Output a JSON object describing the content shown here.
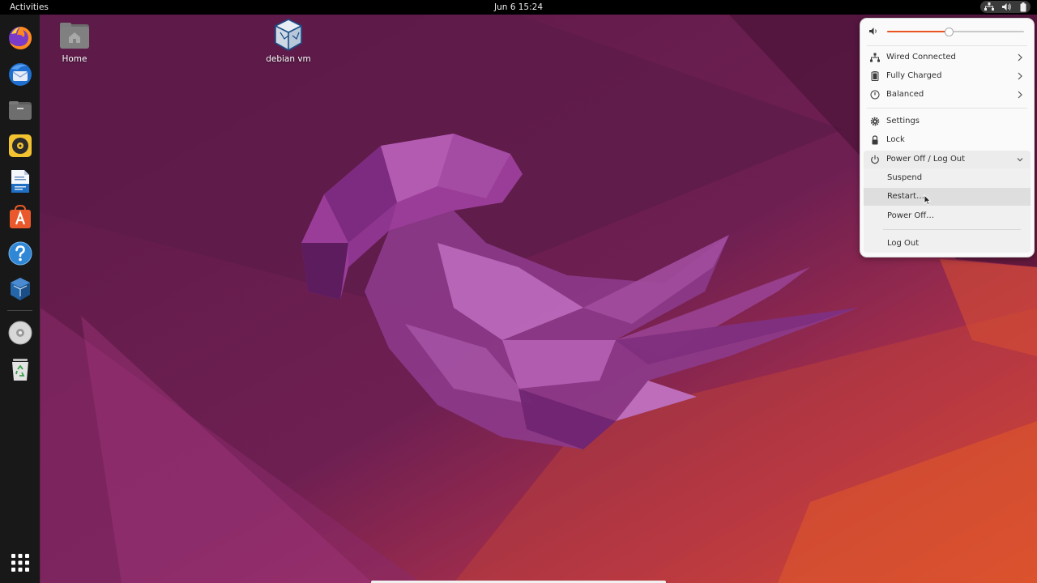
{
  "topbar": {
    "activities": "Activities",
    "clock": "Jun 6  15:24",
    "tray_icons": [
      "network-icon",
      "volume-icon",
      "battery-icon"
    ]
  },
  "dock": {
    "items": [
      {
        "name": "firefox-icon"
      },
      {
        "name": "thunderbird-icon"
      },
      {
        "name": "files-icon"
      },
      {
        "name": "rhythmbox-icon"
      },
      {
        "name": "libreoffice-writer-icon"
      },
      {
        "name": "app-center-icon"
      },
      {
        "name": "help-icon"
      },
      {
        "name": "virtualbox-icon"
      },
      {
        "name": "optical-disc-icon"
      },
      {
        "name": "trash-icon"
      }
    ],
    "apps_grid": "show-apps-icon"
  },
  "desktop": {
    "icons": [
      {
        "label": "Home",
        "icon": "home-folder-icon"
      },
      {
        "label": "debian vm",
        "icon": "virtualbox-vm-icon"
      }
    ]
  },
  "system_menu": {
    "volume": {
      "icon": "speaker-icon",
      "level": 0.45
    },
    "rows": [
      {
        "label": "Wired Connected",
        "icon": "wired-network-icon",
        "submenu": true
      },
      {
        "label": "Fully Charged",
        "icon": "battery-icon",
        "submenu": true
      },
      {
        "label": "Balanced",
        "icon": "power-profile-icon",
        "submenu": true
      }
    ],
    "settings_label": "Settings",
    "lock_label": "Lock",
    "power": {
      "label": "Power Off / Log Out",
      "expanded": true,
      "items": [
        "Suspend",
        "Restart…",
        "Power Off…"
      ],
      "logout": "Log Out"
    },
    "hovered_item": "Restart…"
  },
  "colors": {
    "accent": "#e95420",
    "menu_bg": "#fafafa",
    "topbar_bg": "#000000",
    "dock_bg": "#181818"
  }
}
